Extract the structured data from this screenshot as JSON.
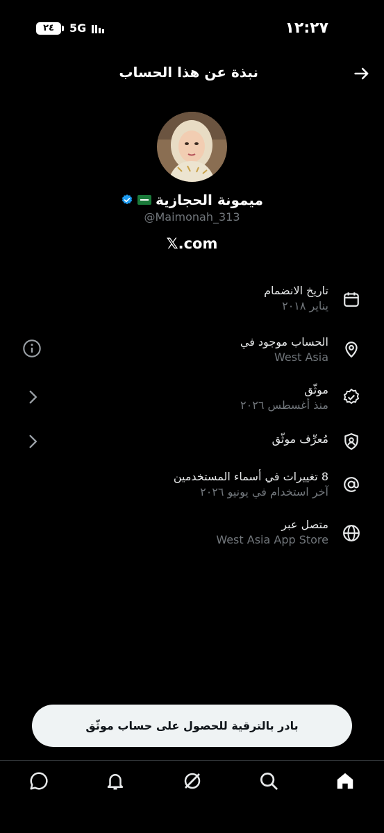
{
  "status_bar": {
    "time": "١٢:٢٧",
    "battery": "٢٤",
    "network": "5G"
  },
  "header": {
    "title": "نبذة عن هذا الحساب",
    "back_icon": "arrow-right-icon"
  },
  "profile": {
    "name": "ميمونة الحجازية",
    "handle": "@Maimonah_313",
    "website": "𝕏.com",
    "verified_color": "#1d9bf0"
  },
  "rows": [
    {
      "title": "تاريخ الانضمام",
      "subtitle": "يناير ٢٠١٨",
      "icon": "calendar-icon"
    },
    {
      "title": "الحساب موجود في",
      "subtitle": "West Asia",
      "icon": "location-pin-icon",
      "side": "info-icon"
    },
    {
      "title": "موثّق",
      "subtitle": "منذ أغسطس ٢٠٢٦",
      "icon": "verified-badge-icon",
      "side": "chevron-left-icon"
    },
    {
      "title": "مُعرِّف موثّق",
      "subtitle": "",
      "icon": "id-shield-icon",
      "side": "chevron-left-icon"
    },
    {
      "title": "8 تغييرات في أسماء المستخدمين",
      "subtitle": "آخر استخدام في يونيو ٢٠٢٦",
      "icon": "at-sign-icon"
    },
    {
      "title": "متصل عبر",
      "subtitle": "West Asia App Store",
      "icon": "globe-icon"
    }
  ],
  "upgrade_button": "بادر بالترقية للحصول على حساب موثّق",
  "bottom_nav": [
    "chat-icon",
    "bell-icon",
    "grok-icon",
    "search-icon",
    "home-icon"
  ]
}
